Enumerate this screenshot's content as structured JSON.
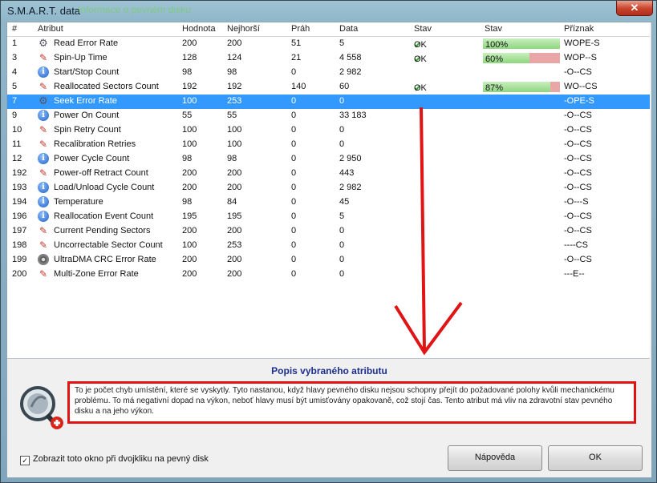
{
  "window": {
    "title": "S.M.A.R.T. data",
    "title_ghost": "Informace o pevném disku",
    "close_glyph": "✕"
  },
  "columns": [
    "#",
    "Atribut",
    "Hodnota",
    "Nejhorší",
    "Práh",
    "Data",
    "Stav",
    "Stav",
    "Příznak"
  ],
  "rows": [
    {
      "id": "1",
      "icon": "gear",
      "name": "Read Error Rate",
      "value": "200",
      "worst": "200",
      "thresh": "51",
      "data": "5",
      "status": "OK",
      "bar": "100%",
      "bar_fraction": 1.0,
      "flags": "WOPE-S"
    },
    {
      "id": "3",
      "icon": "wrench",
      "name": "Spin-Up Time",
      "value": "128",
      "worst": "124",
      "thresh": "21",
      "data": "4 558",
      "status": "OK",
      "bar": "60%",
      "bar_fraction": 0.6,
      "flags": "WOP--S"
    },
    {
      "id": "4",
      "icon": "info",
      "name": "Start/Stop Count",
      "value": "98",
      "worst": "98",
      "thresh": "0",
      "data": "2 982",
      "status": "",
      "bar": "",
      "bar_fraction": null,
      "flags": "-O--CS"
    },
    {
      "id": "5",
      "icon": "wrench",
      "name": "Reallocated Sectors Count",
      "value": "192",
      "worst": "192",
      "thresh": "140",
      "data": "60",
      "status": "OK",
      "bar": "87%",
      "bar_fraction": 0.87,
      "flags": "WO--CS"
    },
    {
      "id": "7",
      "icon": "gear",
      "name": "Seek Error Rate",
      "value": "100",
      "worst": "253",
      "thresh": "0",
      "data": "0",
      "status": "",
      "bar": "",
      "bar_fraction": null,
      "flags": "-OPE-S",
      "selected": true
    },
    {
      "id": "9",
      "icon": "info",
      "name": "Power On Count",
      "value": "55",
      "worst": "55",
      "thresh": "0",
      "data": "33 183",
      "status": "",
      "bar": "",
      "bar_fraction": null,
      "flags": "-O--CS"
    },
    {
      "id": "10",
      "icon": "wrench",
      "name": "Spin Retry Count",
      "value": "100",
      "worst": "100",
      "thresh": "0",
      "data": "0",
      "status": "",
      "bar": "",
      "bar_fraction": null,
      "flags": "-O--CS"
    },
    {
      "id": "11",
      "icon": "wrench",
      "name": "Recalibration Retries",
      "value": "100",
      "worst": "100",
      "thresh": "0",
      "data": "0",
      "status": "",
      "bar": "",
      "bar_fraction": null,
      "flags": "-O--CS"
    },
    {
      "id": "12",
      "icon": "info",
      "name": "Power Cycle Count",
      "value": "98",
      "worst": "98",
      "thresh": "0",
      "data": "2 950",
      "status": "",
      "bar": "",
      "bar_fraction": null,
      "flags": "-O--CS"
    },
    {
      "id": "192",
      "icon": "wrench",
      "name": "Power-off Retract Count",
      "value": "200",
      "worst": "200",
      "thresh": "0",
      "data": "443",
      "status": "",
      "bar": "",
      "bar_fraction": null,
      "flags": "-O--CS"
    },
    {
      "id": "193",
      "icon": "info",
      "name": "Load/Unload Cycle Count",
      "value": "200",
      "worst": "200",
      "thresh": "0",
      "data": "2 982",
      "status": "",
      "bar": "",
      "bar_fraction": null,
      "flags": "-O--CS"
    },
    {
      "id": "194",
      "icon": "info",
      "name": "Temperature",
      "value": "98",
      "worst": "84",
      "thresh": "0",
      "data": "45",
      "status": "",
      "bar": "",
      "bar_fraction": null,
      "flags": "-O---S"
    },
    {
      "id": "196",
      "icon": "info",
      "name": "Reallocation Event Count",
      "value": "195",
      "worst": "195",
      "thresh": "0",
      "data": "5",
      "status": "",
      "bar": "",
      "bar_fraction": null,
      "flags": "-O--CS"
    },
    {
      "id": "197",
      "icon": "wrench",
      "name": "Current Pending Sectors",
      "value": "200",
      "worst": "200",
      "thresh": "0",
      "data": "0",
      "status": "",
      "bar": "",
      "bar_fraction": null,
      "flags": "-O--CS"
    },
    {
      "id": "198",
      "icon": "wrench",
      "name": "Uncorrectable Sector Count",
      "value": "100",
      "worst": "253",
      "thresh": "0",
      "data": "0",
      "status": "",
      "bar": "",
      "bar_fraction": null,
      "flags": "----CS"
    },
    {
      "id": "199",
      "icon": "disk",
      "name": "UltraDMA CRC Error Rate",
      "value": "200",
      "worst": "200",
      "thresh": "0",
      "data": "0",
      "status": "",
      "bar": "",
      "bar_fraction": null,
      "flags": "-O--CS"
    },
    {
      "id": "200",
      "icon": "wrench",
      "name": "Multi-Zone Error Rate",
      "value": "200",
      "worst": "200",
      "thresh": "0",
      "data": "0",
      "status": "",
      "bar": "",
      "bar_fraction": null,
      "flags": "---E--"
    }
  ],
  "description": {
    "title": "Popis vybraného atributu",
    "text": "To je počet chyb umístění, které se vyskytly. Tyto nastanou, když hlavy pevného disku nejsou schopny přejít do požadované polohy kvůli mechanickému problému. To má negativní dopad na výkon, neboť hlavy musí být umisťovány opakovaně, což stojí čas. Tento atribut má vliv na zdravotní stav pevného disku a na jeho výkon."
  },
  "footer": {
    "checkbox_label": "Zobrazit toto okno při dvojkliku na pevný disk",
    "checkbox_checked": true,
    "help_label": "Nápověda",
    "ok_label": "OK"
  },
  "colors": {
    "selection": "#3399ff",
    "annotation": "#e01414",
    "bar_good": "#8fd67f",
    "bar_bad": "#e8a6a6"
  }
}
